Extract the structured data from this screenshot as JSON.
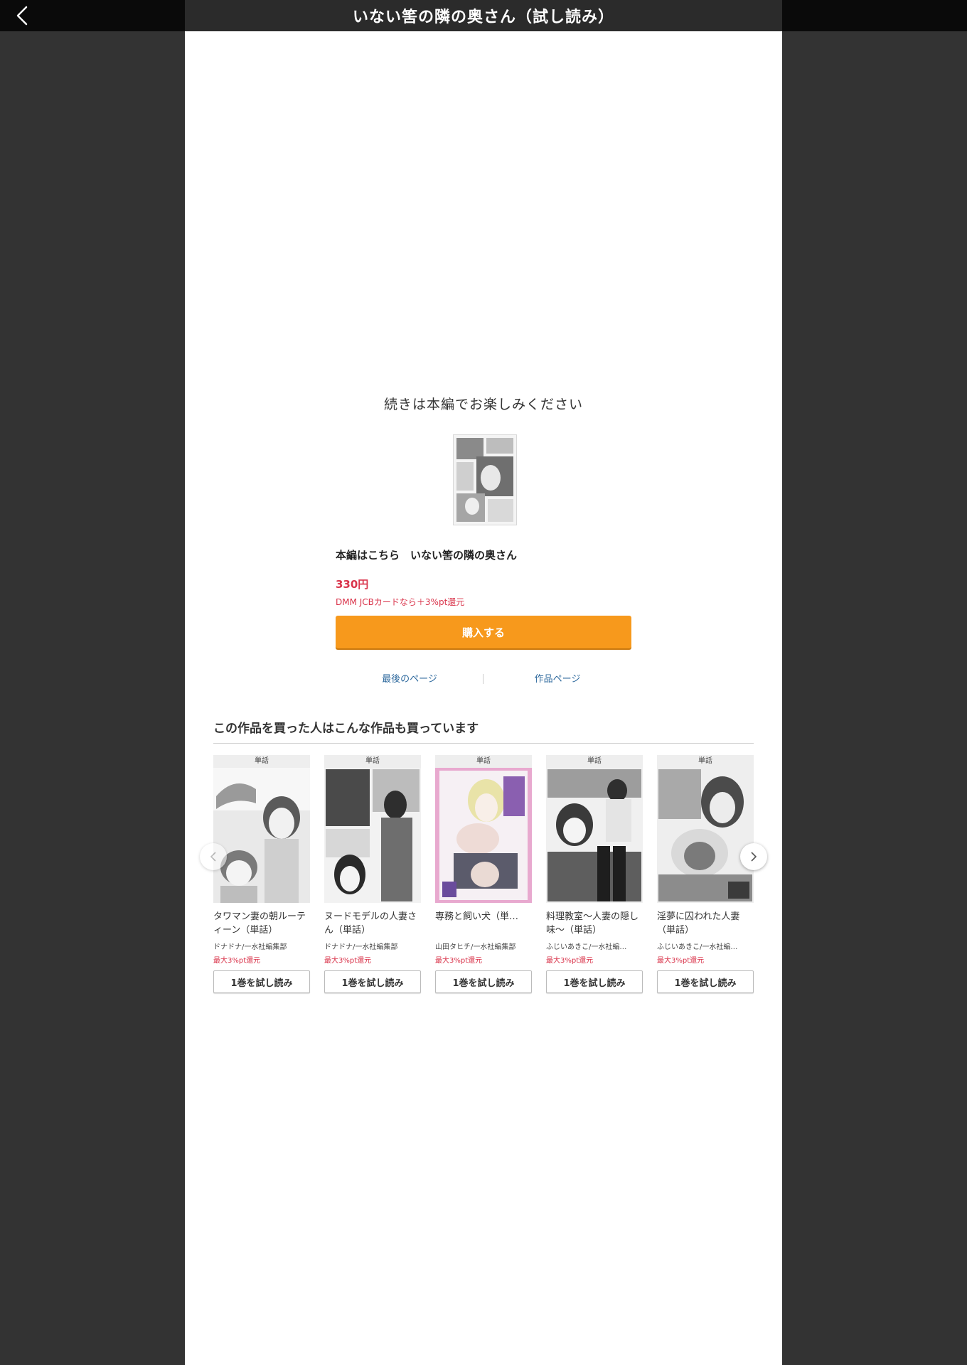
{
  "header": {
    "title": "いない筈の隣の奥さん（試し読み）",
    "back_icon": "chevron-left-icon"
  },
  "end_panel": {
    "continue_text": "続きは本編でお楽しみください",
    "main_title": "本編はこちら　いない筈の隣の奥さん",
    "price": "330円",
    "point_note": "DMM JCBカードなら＋3%pt還元",
    "buy_label": "購入する",
    "last_page_label": "最後のページ",
    "work_page_label": "作品ページ"
  },
  "recommend": {
    "heading": "この作品を買った人はこんな作品も買っています",
    "items": [
      {
        "badge": "単話",
        "title": "タワマン妻の朝ルーティーン（単話）",
        "author": "ドナドナ/一水社編集部",
        "point": "最大3%pt還元",
        "trial_label": "1巻を試し読み"
      },
      {
        "badge": "単話",
        "title": "ヌードモデルの人妻さん（単話）",
        "author": "ドナドナ/一水社編集部",
        "point": "最大3%pt還元",
        "trial_label": "1巻を試し読み"
      },
      {
        "badge": "単話",
        "title": "専務と飼い犬（単…",
        "author": "山田タヒチ/一水社編集部",
        "point": "最大3%pt還元",
        "trial_label": "1巻を試し読み"
      },
      {
        "badge": "単話",
        "title": "料理教室～人妻の隠し味～（単話）",
        "author": "ふじいあきこ/一水社編…",
        "point": "最大3%pt還元",
        "trial_label": "1巻を試し読み"
      },
      {
        "badge": "単話",
        "title": "淫夢に囚われた人妻（単話）",
        "author": "ふじいあきこ/一水社編…",
        "point": "最大3%pt還元",
        "trial_label": "1巻を試し読み"
      }
    ]
  },
  "colors": {
    "accent": "#f7991c",
    "price_red": "#d9334a",
    "link_blue": "#2f6a9e"
  }
}
